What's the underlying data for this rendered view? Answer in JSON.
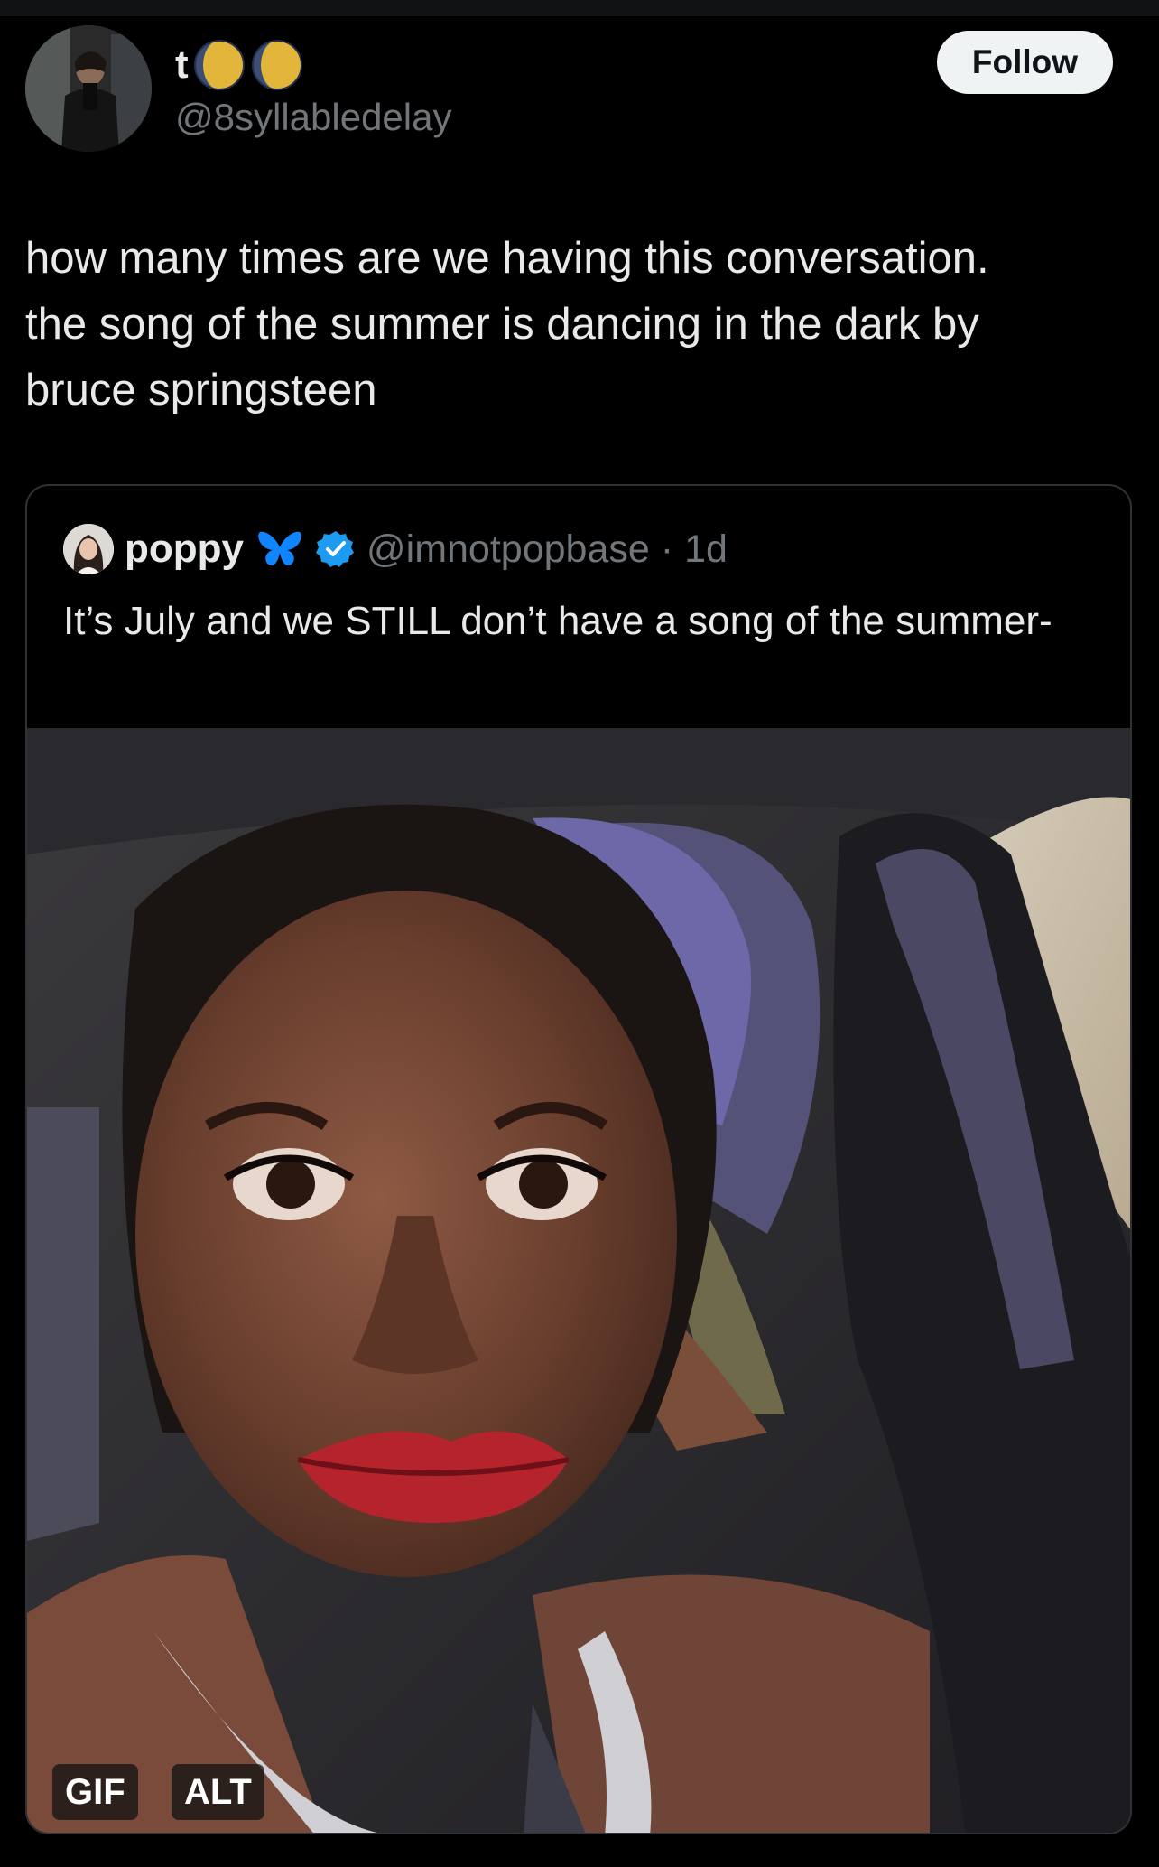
{
  "author": {
    "display_name": "t",
    "handle": "@8syllabledelay",
    "name_emojis": [
      "moon-icon",
      "moon-icon"
    ]
  },
  "follow_button": {
    "label": "Follow"
  },
  "tweet": {
    "text": "how many times are we having this conversation.\nthe song of the summer is dancing in the dark by\nbruce springsteen"
  },
  "quoted_tweet": {
    "display_name": "poppy",
    "name_icon": "butterfly-icon",
    "verified_icon": "verified-badge-icon",
    "handle": "@imnotpopbase",
    "separator": "·",
    "time": "1d",
    "text": "It’s July and we STILL don’t have a song of the summer-",
    "media": {
      "type": "gif",
      "gif_label": "GIF",
      "alt_label": "ALT"
    }
  },
  "colors": {
    "background": "#000000",
    "text_primary": "#e7e9ea",
    "text_secondary": "#71767b",
    "border": "#2f3336",
    "follow_bg": "#eff3f4",
    "verified": "#1d9bf0",
    "butterfly": "#1185fe"
  }
}
